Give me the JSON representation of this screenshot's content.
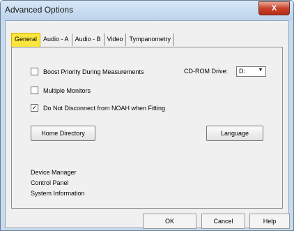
{
  "window": {
    "title": "Advanced Options",
    "close_glyph": "X"
  },
  "tabs": [
    {
      "label": "General",
      "active": true
    },
    {
      "label": "Audio - A",
      "active": false
    },
    {
      "label": "Audio - B",
      "active": false
    },
    {
      "label": "Video",
      "active": false
    },
    {
      "label": "Tympanometry",
      "active": false
    }
  ],
  "options": {
    "boost": {
      "label": "Boost Priority During Measurements",
      "checked": false,
      "mark": ""
    },
    "multi": {
      "label": "Multiple Monitors",
      "checked": false,
      "mark": ""
    },
    "noah": {
      "label": "Do Not Disconnect from NOAH when Fitting",
      "checked": true,
      "mark": "✓"
    }
  },
  "cdrom": {
    "label": "CD-ROM Drive:",
    "value": "D:",
    "arrow": "▼"
  },
  "buttons": {
    "home_directory": "Home Directory",
    "language": "Language",
    "ok": "OK",
    "cancel": "Cancel",
    "help": "Help"
  },
  "links": [
    "Device Manager",
    "Control Panel",
    "System Information"
  ],
  "colors": {
    "active_tab": "#fbe640",
    "title_gradient": "#c7daee",
    "close_button": "#c7422a"
  }
}
